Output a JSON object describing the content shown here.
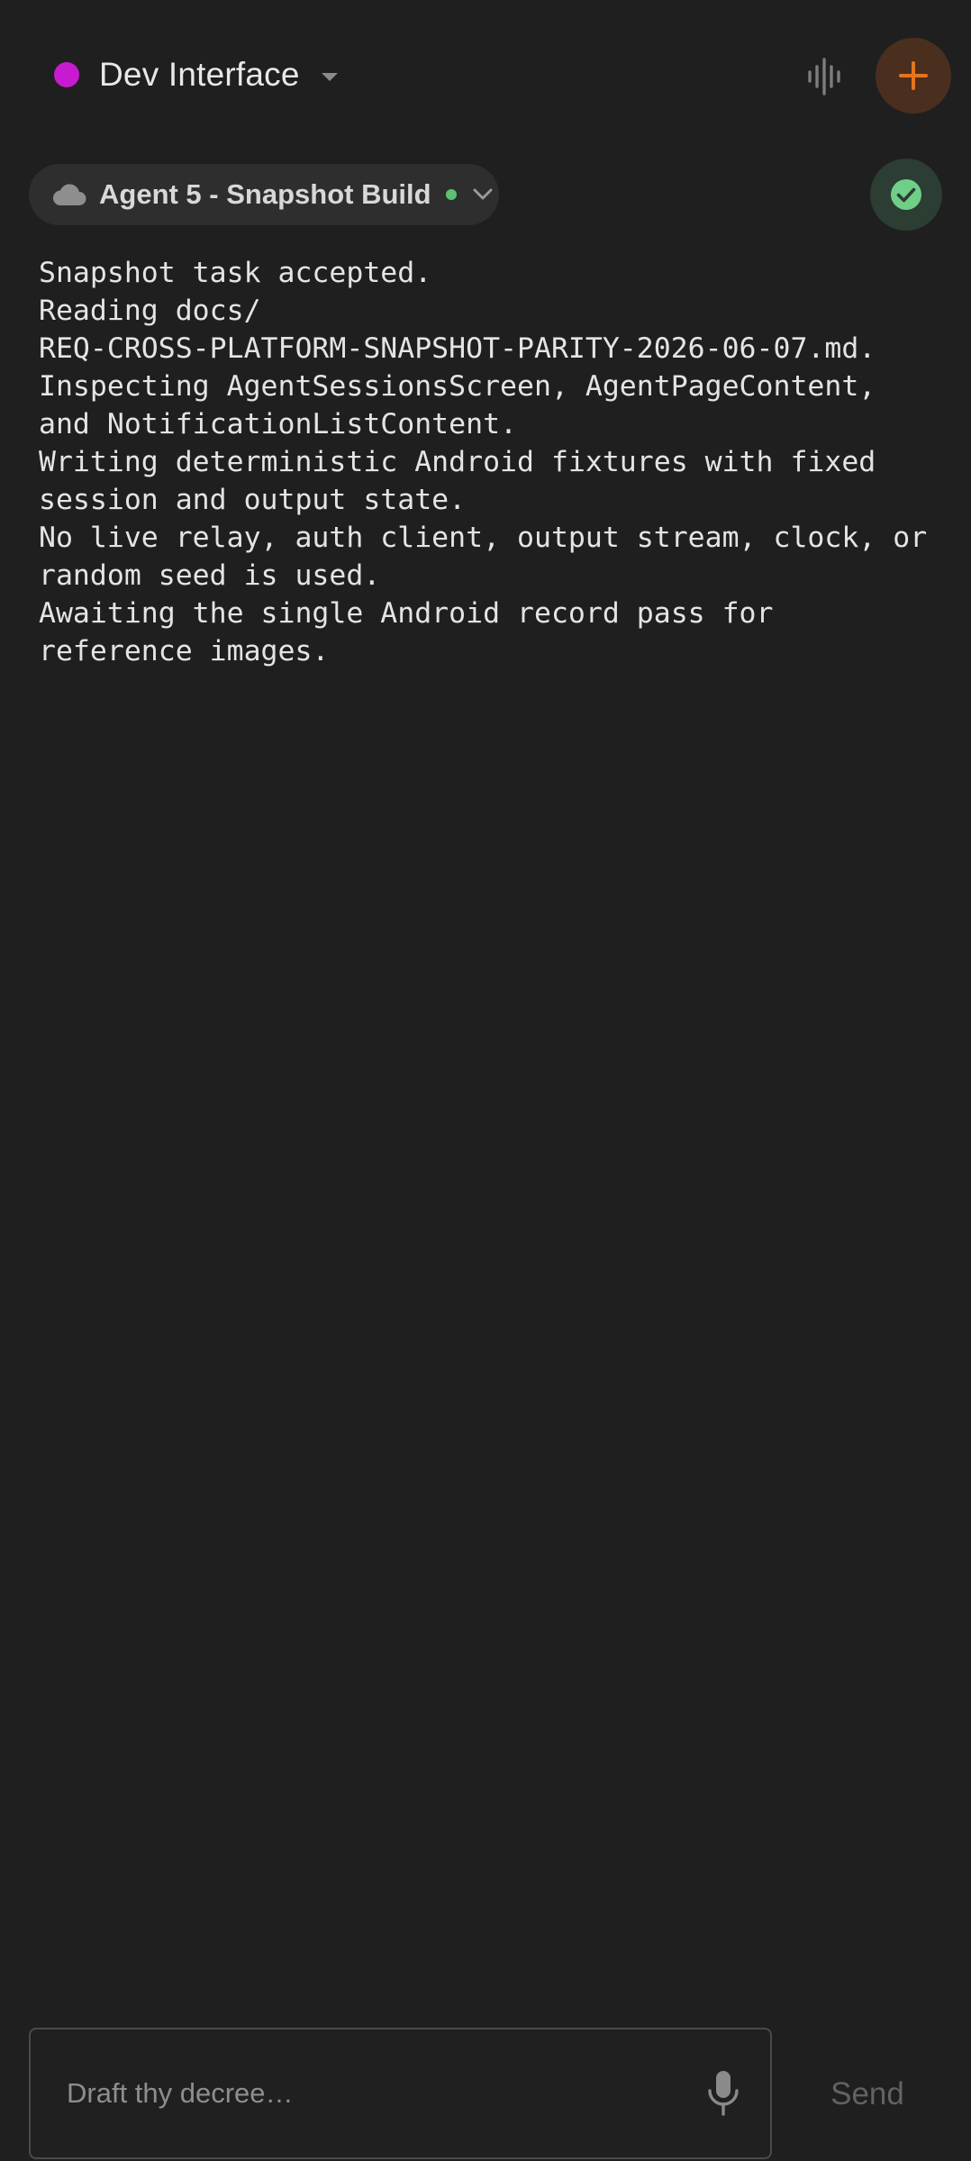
{
  "header": {
    "project_name": "Dev Interface",
    "project_color": "#c81ad0",
    "project_caret_icon": "caret-down-icon",
    "voice_icon": "audio-waveform-icon",
    "new_icon": "plus-icon",
    "new_accent": "#e8741c"
  },
  "agent": {
    "cloud_icon": "cloud-icon",
    "name": "Agent 5 - Snapshot Build",
    "status_color": "#5cc172",
    "chevron_icon": "chevron-down-icon",
    "check_icon": "check-circle-icon",
    "check_color": "#6fcf88"
  },
  "output": {
    "lines": [
      "Snapshot task accepted.",
      "Reading docs/",
      "REQ-CROSS-PLATFORM-SNAPSHOT-PARITY-2026-06-07.md.",
      "Inspecting AgentSessionsScreen, AgentPageContent,",
      "and NotificationListContent.",
      "Writing deterministic Android fixtures with fixed",
      "session and output state.",
      "No live relay, auth client, output stream, clock, or",
      "random seed is used.",
      "Awaiting the single Android record pass for",
      "reference images."
    ]
  },
  "composer": {
    "placeholder": "Draft thy decree…",
    "value": "",
    "mic_icon": "microphone-icon",
    "send_label": "Send"
  }
}
